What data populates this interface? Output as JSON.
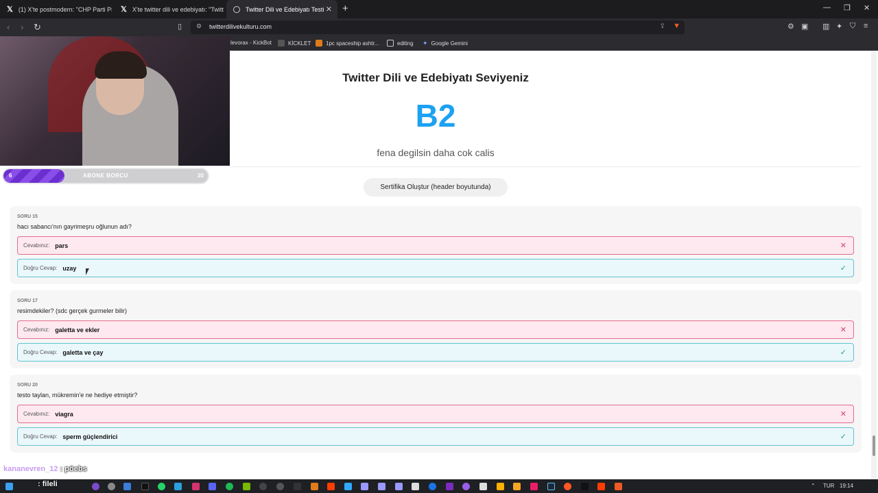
{
  "browser": {
    "tabs": [
      {
        "label": "(1) X'te postmodern: \"CHP Parti Prog"
      },
      {
        "label": "X'te twitter dili ve edebiyatı: \"Twitter"
      },
      {
        "label": "Twitter Dili ve Edebiyatı Testi"
      }
    ],
    "url": "twitterdilivekulturu.com",
    "bookmarks": [
      {
        "label": "levorax - KickBot"
      },
      {
        "label": "KİCKLET"
      },
      {
        "label": "1pc spaceship ashtr..."
      },
      {
        "label": "editing"
      },
      {
        "label": "Google Gemini"
      }
    ]
  },
  "overlay": {
    "sub_goal": {
      "label": "ABONE BORCU",
      "current": "6",
      "max": "20",
      "progress": 0.3
    },
    "chat": {
      "user": "kananevren_12",
      "separator": ":",
      "message": "pöebs"
    },
    "chat2": {
      "user": "",
      "message": ": fileli"
    }
  },
  "result": {
    "title": "Twitter Dili ve Edebiyatı Seviyeniz",
    "level": "B2",
    "subtitle": "fena degilsin daha cok calis",
    "certificate_button": "Sertifika Oluştur (header boyutunda)"
  },
  "labels": {
    "your_answer": "Cevabınız:",
    "correct_answer": "Doğru Cevap:"
  },
  "questions": [
    {
      "number": "SORU 15",
      "text": "hacı sabancı'nın gayrimeşru oğlunun adı?",
      "your_answer": "pars",
      "correct_answer": "uzay"
    },
    {
      "number": "SORU 17",
      "text": "resimdekiler? (sdc gerçek gurmeler bilir)",
      "your_answer": "galetta ve ekler",
      "correct_answer": "galetta ve çay"
    },
    {
      "number": "SORU 20",
      "text": "testo taylan, mükremin'e ne hediye etmiştir?",
      "your_answer": "viagra",
      "correct_answer": "sperm güçlendirici"
    }
  ],
  "taskbar": {
    "lang": "TUR",
    "time": "19:14"
  }
}
